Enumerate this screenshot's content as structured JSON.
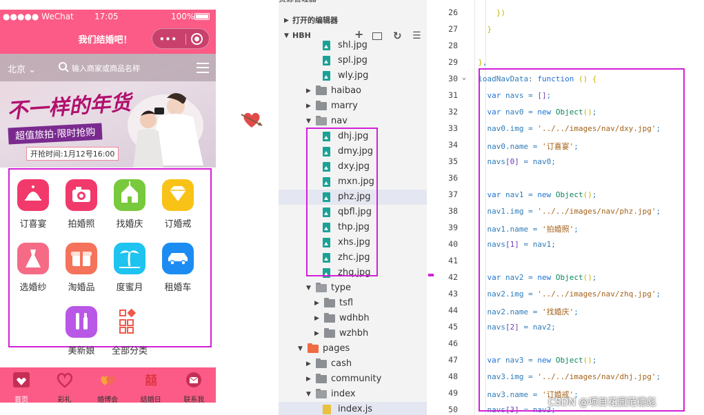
{
  "phone": {
    "status": {
      "carrier": "●●●●● WeChat",
      "time": "17:05",
      "battery": "100%"
    },
    "nav_title": "我们结婚吧！",
    "capsule_dots": "•••",
    "search": {
      "city": "北京",
      "placeholder": "输入商家或商品名称"
    },
    "banner": {
      "headline": "不一样的年货",
      "subline": "超值旅拍·限时抢购",
      "time_label": "开抢时间:1月12号16:00"
    },
    "grid": [
      {
        "label": "订喜宴",
        "icon": "dome-icon",
        "color": "#f2396b"
      },
      {
        "label": "拍婚照",
        "icon": "camera-icon",
        "color": "#f2396b"
      },
      {
        "label": "找婚庆",
        "icon": "chapel-icon",
        "color": "#78c93b"
      },
      {
        "label": "订婚戒",
        "icon": "diamond-icon",
        "color": "#f9c217"
      },
      {
        "label": "选婚纱",
        "icon": "dress-icon",
        "color": "#f56b86"
      },
      {
        "label": "淘婚品",
        "icon": "gift-icon",
        "color": "#f4735a"
      },
      {
        "label": "度蜜月",
        "icon": "palm-icon",
        "color": "#1ec3f0"
      },
      {
        "label": "租婚车",
        "icon": "car-icon",
        "color": "#1d8cf2"
      },
      {
        "label": "美新娘",
        "icon": "makeup-icon",
        "color": "#b957e6"
      },
      {
        "label": "全部分类",
        "icon": "categories-icon",
        "color": "#ffffff"
      }
    ],
    "tabs": [
      {
        "label": "首页",
        "icon": "home-icon"
      },
      {
        "label": "彩礼",
        "icon": "heart-icon"
      },
      {
        "label": "婚博会",
        "icon": "hearts-icon"
      },
      {
        "label": "结婚日",
        "icon": "double-happiness-icon"
      },
      {
        "label": "联系我",
        "icon": "envelope-icon"
      }
    ]
  },
  "explorer": {
    "title": "资源管理器",
    "open_editors": "打开的编辑器",
    "project": "HBH",
    "rows": [
      {
        "name": "shl.jpg",
        "kind": "img",
        "indent": 2
      },
      {
        "name": "spl.jpg",
        "kind": "img",
        "indent": 2
      },
      {
        "name": "wly.jpg",
        "kind": "img",
        "indent": 2
      },
      {
        "name": "haibao",
        "kind": "folder",
        "indent": 1
      },
      {
        "name": "marry",
        "kind": "folder",
        "indent": 1
      },
      {
        "name": "nav",
        "kind": "folder-open",
        "indent": 1
      },
      {
        "name": "dhj.jpg",
        "kind": "img",
        "indent": 2
      },
      {
        "name": "dmy.jpg",
        "kind": "img",
        "indent": 2
      },
      {
        "name": "dxy.jpg",
        "kind": "img",
        "indent": 2
      },
      {
        "name": "mxn.jpg",
        "kind": "img",
        "indent": 2
      },
      {
        "name": "phz.jpg",
        "kind": "img",
        "indent": 2,
        "selected": true
      },
      {
        "name": "qbfl.jpg",
        "kind": "img",
        "indent": 2
      },
      {
        "name": "thp.jpg",
        "kind": "img",
        "indent": 2
      },
      {
        "name": "xhs.jpg",
        "kind": "img",
        "indent": 2
      },
      {
        "name": "zhc.jpg",
        "kind": "img",
        "indent": 2
      },
      {
        "name": "zhq.jpg",
        "kind": "img",
        "indent": 2
      },
      {
        "name": "type",
        "kind": "folder-open",
        "indent": 1
      },
      {
        "name": "tsfl",
        "kind": "folder",
        "indent": 2
      },
      {
        "name": "wdhbh",
        "kind": "folder",
        "indent": 2
      },
      {
        "name": "wzhbh",
        "kind": "folder",
        "indent": 2
      },
      {
        "name": "pages",
        "kind": "folder-red",
        "indent": 0
      },
      {
        "name": "cash",
        "kind": "folder",
        "indent": 1
      },
      {
        "name": "community",
        "kind": "folder",
        "indent": 1
      },
      {
        "name": "index",
        "kind": "folder-open",
        "indent": 1
      },
      {
        "name": "index.js",
        "kind": "js",
        "indent": 2,
        "selected": true
      }
    ]
  },
  "editor": {
    "lines": [
      {
        "n": "26",
        "t": "      })"
      },
      {
        "n": "27",
        "t": "    }"
      },
      {
        "n": "28",
        "t": ""
      },
      {
        "n": "29",
        "t": "  },"
      },
      {
        "n": "30",
        "t": "  loadNavData: function () {"
      },
      {
        "n": "31",
        "t": "    var navs = [];"
      },
      {
        "n": "32",
        "t": "    var nav0 = new Object();"
      },
      {
        "n": "33",
        "t": "    nav0.img = '../../images/nav/dxy.jpg';"
      },
      {
        "n": "34",
        "t": "    nav0.name = '订喜宴';"
      },
      {
        "n": "35",
        "t": "    navs[0] = nav0;"
      },
      {
        "n": "36",
        "t": ""
      },
      {
        "n": "37",
        "t": "    var nav1 = new Object();"
      },
      {
        "n": "38",
        "t": "    nav1.img = '../../images/nav/phz.jpg';"
      },
      {
        "n": "39",
        "t": "    nav1.name = '拍婚照';"
      },
      {
        "n": "40",
        "t": "    navs[1] = nav1;"
      },
      {
        "n": "41",
        "t": ""
      },
      {
        "n": "42",
        "t": "    var nav2 = new Object();"
      },
      {
        "n": "43",
        "t": "    nav2.img = '../../images/nav/zhq.jpg';"
      },
      {
        "n": "44",
        "t": "    nav2.name = '找婚庆';"
      },
      {
        "n": "45",
        "t": "    navs[2] = nav2;"
      },
      {
        "n": "46",
        "t": ""
      },
      {
        "n": "47",
        "t": "    var nav3 = new Object();"
      },
      {
        "n": "48",
        "t": "    nav3.img = '../../images/nav/dhj.jpg';"
      },
      {
        "n": "49",
        "t": "    nav3.name = '订婚戒';"
      },
      {
        "n": "50",
        "t": "    navs[3] = nav3;"
      }
    ],
    "watermark": "CSDN @项目花园范德彪"
  }
}
